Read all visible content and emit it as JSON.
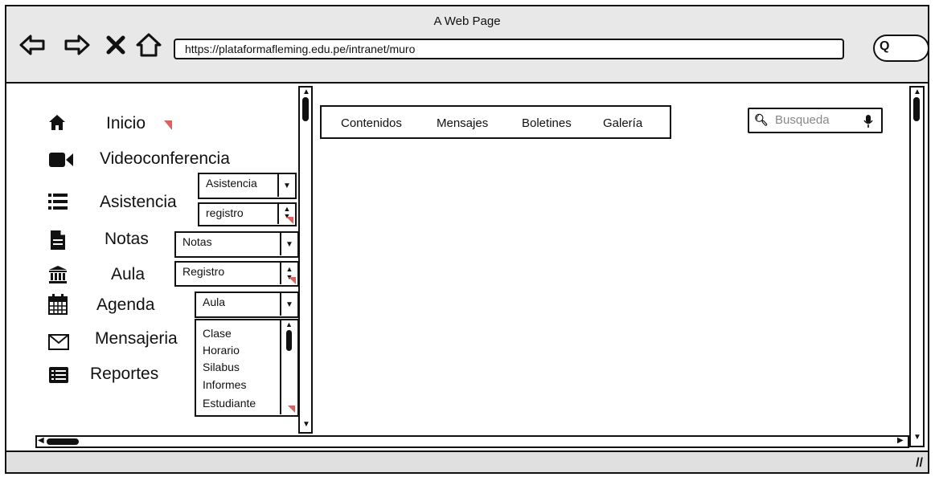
{
  "window": {
    "title": "A Web Page"
  },
  "nav": {
    "back_icon": "arrow-left-icon",
    "forward_icon": "arrow-right-icon",
    "stop_icon": "close-icon",
    "home_icon": "home-icon",
    "url": "https://plataformafleming.edu.pe/intranet/muro",
    "search_icon": "search-icon"
  },
  "sidebar": {
    "items": [
      {
        "label": "Inicio",
        "icon": "home-icon"
      },
      {
        "label": "Videoconferencia",
        "icon": "video-camera-icon"
      },
      {
        "label": "Asistencia",
        "icon": "list-icon"
      },
      {
        "label": "Notas",
        "icon": "document-icon"
      },
      {
        "label": "Aula",
        "icon": "institution-icon"
      },
      {
        "label": "Agenda",
        "icon": "calendar-icon"
      },
      {
        "label": "Mensajeria",
        "icon": "envelope-icon"
      },
      {
        "label": "Reportes",
        "icon": "report-icon"
      }
    ],
    "asistencia_dropdown": "Asistencia",
    "asistencia_stepper": "registro",
    "notas_dropdown": "Notas",
    "notas_stepper": "Registro",
    "aula_dropdown": "Aula",
    "aula_list": [
      "Clase",
      "Horario",
      "Silabus",
      "Informes",
      "Estudiante"
    ]
  },
  "main": {
    "tabs": [
      "Contenidos",
      "Mensajes",
      "Boletines",
      "Galería"
    ],
    "search_placeholder": "Busqueda"
  },
  "colors": {
    "accent": "#e06060",
    "chrome": "#e8e8e8"
  }
}
